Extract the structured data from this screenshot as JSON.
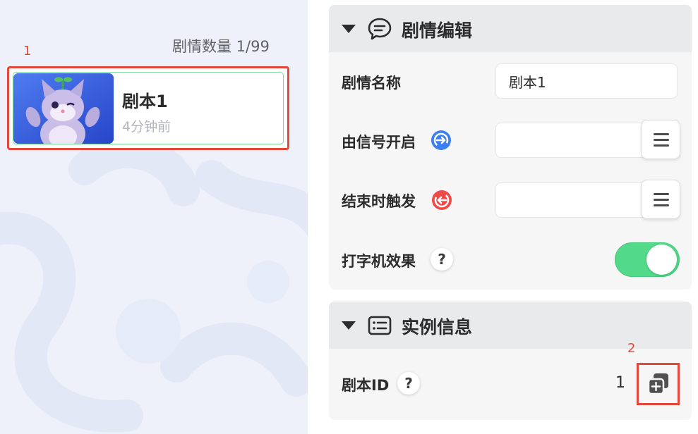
{
  "left_panel": {
    "count_label": "剧情数量 1/99",
    "annotation_1": "1",
    "script_card": {
      "title": "剧本1",
      "time": "4分钟前",
      "thumbnail_icon": "cat-character-thumbnail"
    }
  },
  "right_panel": {
    "section_plot": {
      "title": "剧情编辑",
      "icon": "speech-bubble-icon",
      "name_label": "剧情名称",
      "name_value": "剧本1",
      "signal_start_label": "由信号开启",
      "end_trigger_label": "结束时触发",
      "typewriter_label": "打字机效果",
      "typewriter_on": true
    },
    "section_instance": {
      "title": "实例信息",
      "icon": "info-list-icon",
      "script_id_label": "剧本ID",
      "script_id_value": "1",
      "annotation_2": "2"
    },
    "help_symbol": "?"
  },
  "colors": {
    "toggle_on": "#52d98a",
    "signal_in": "#3b7ff0",
    "signal_out": "#ef4a4a",
    "annotation": "#e5483a"
  }
}
